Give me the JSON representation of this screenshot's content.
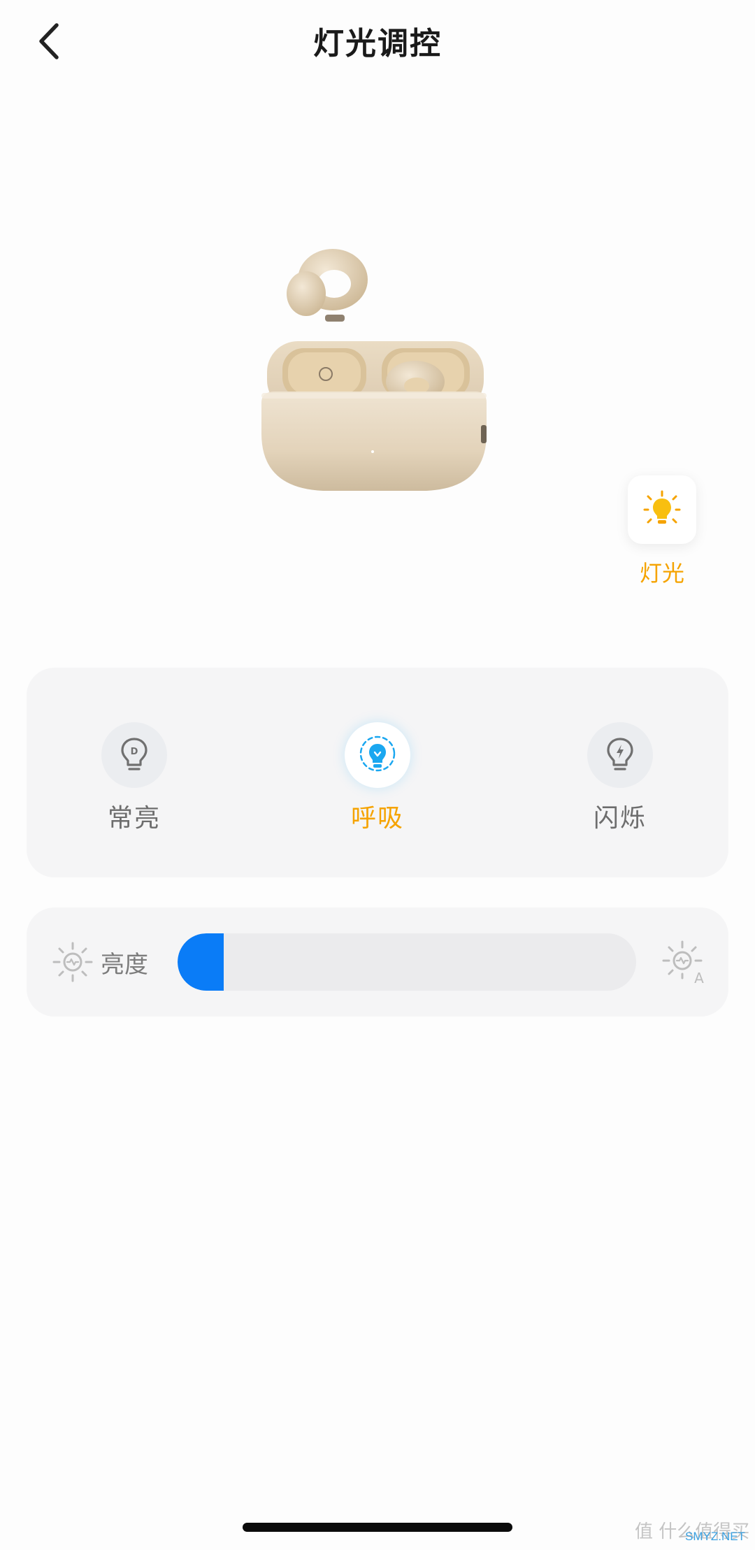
{
  "header": {
    "title": "灯光调控"
  },
  "light_button": {
    "label": "灯光",
    "icon": "lightbulb-glow-icon",
    "color": "#f5a300"
  },
  "modes": {
    "selected": "呼吸",
    "items": [
      {
        "label": "常亮",
        "icon": "bulb-steady-icon",
        "active": false
      },
      {
        "label": "呼吸",
        "icon": "bulb-breathing-icon",
        "active": true
      },
      {
        "label": "闪烁",
        "icon": "bulb-flash-icon",
        "active": false
      }
    ],
    "active_color": "#f5a300",
    "active_icon_color": "#1aa7f0"
  },
  "brightness": {
    "label": "亮度",
    "value_fraction": 0.1,
    "fill_color": "#0a7cf7",
    "left_icon": "brightness-low-icon",
    "right_icon": "brightness-auto-icon",
    "auto_mark": "A"
  },
  "watermark": {
    "text": "值 什么值得买",
    "site": "SMYZ.NET"
  }
}
